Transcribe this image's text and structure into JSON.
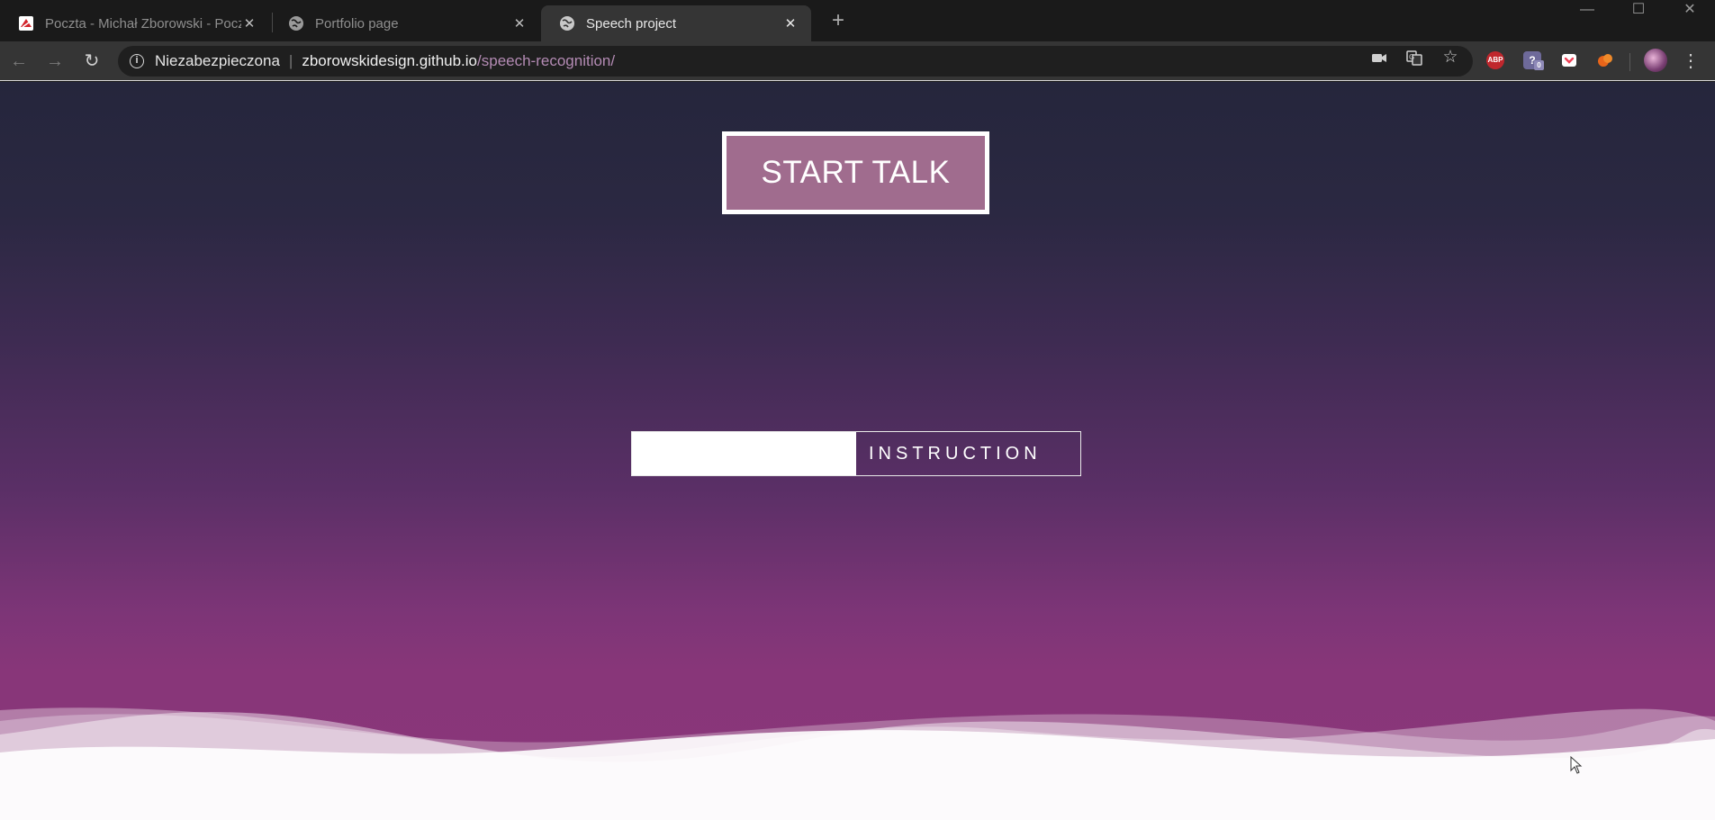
{
  "tabs": [
    {
      "title": "Poczta - Michał Zborowski - Poczta",
      "icon": "mail-favicon-icon",
      "active": false
    },
    {
      "title": "Portfolio page",
      "icon": "globe-icon",
      "active": false
    },
    {
      "title": "Speech project",
      "icon": "globe-icon",
      "active": true
    }
  ],
  "address_bar": {
    "security_label": "Niezabezpieczona",
    "host": "zborowskidesign.github.io",
    "path": "/speech-recognition/"
  },
  "toolbar_icons": [
    "back-icon",
    "forward-icon",
    "reload-icon",
    "camera-icon",
    "translate-icon",
    "star-icon"
  ],
  "extensions": [
    {
      "name": "adblock-plus-icon",
      "text": "ABP",
      "color": "#c0272d"
    },
    {
      "name": "privacy-extension-icon",
      "text": "?",
      "badge": "0",
      "color": "#6e6a9a"
    },
    {
      "name": "pocket-icon",
      "text": "",
      "color": "#ef4056"
    },
    {
      "name": "honey-extension-icon",
      "text": "",
      "color": "#e8651a"
    }
  ],
  "page": {
    "start_button": "START TALK",
    "instruction_label": "INSTRUCTION"
  },
  "colors": {
    "button_bg": "#a06c8e",
    "gradient_top": "#25263c",
    "gradient_bottom": "#8a377a",
    "wave": "#ffffff"
  }
}
